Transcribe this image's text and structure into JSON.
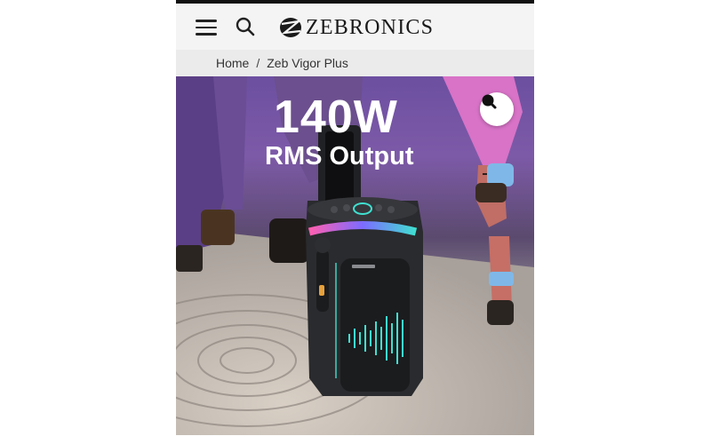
{
  "header": {
    "menu_icon": "hamburger-menu-icon",
    "search_icon": "search-icon",
    "logo_text": "ZEBRONICS"
  },
  "breadcrumb": {
    "home": "Home",
    "separator": "/",
    "current": "Zeb Vigor Plus"
  },
  "hero": {
    "headline_big": "140W",
    "headline_sub": "RMS Output",
    "zoom_icon": "zoom-search-icon",
    "colors": {
      "accent_teal": "#3fe0d0",
      "accent_purple": "#7d5aa8",
      "speaker_body": "#2a2b2e"
    }
  }
}
